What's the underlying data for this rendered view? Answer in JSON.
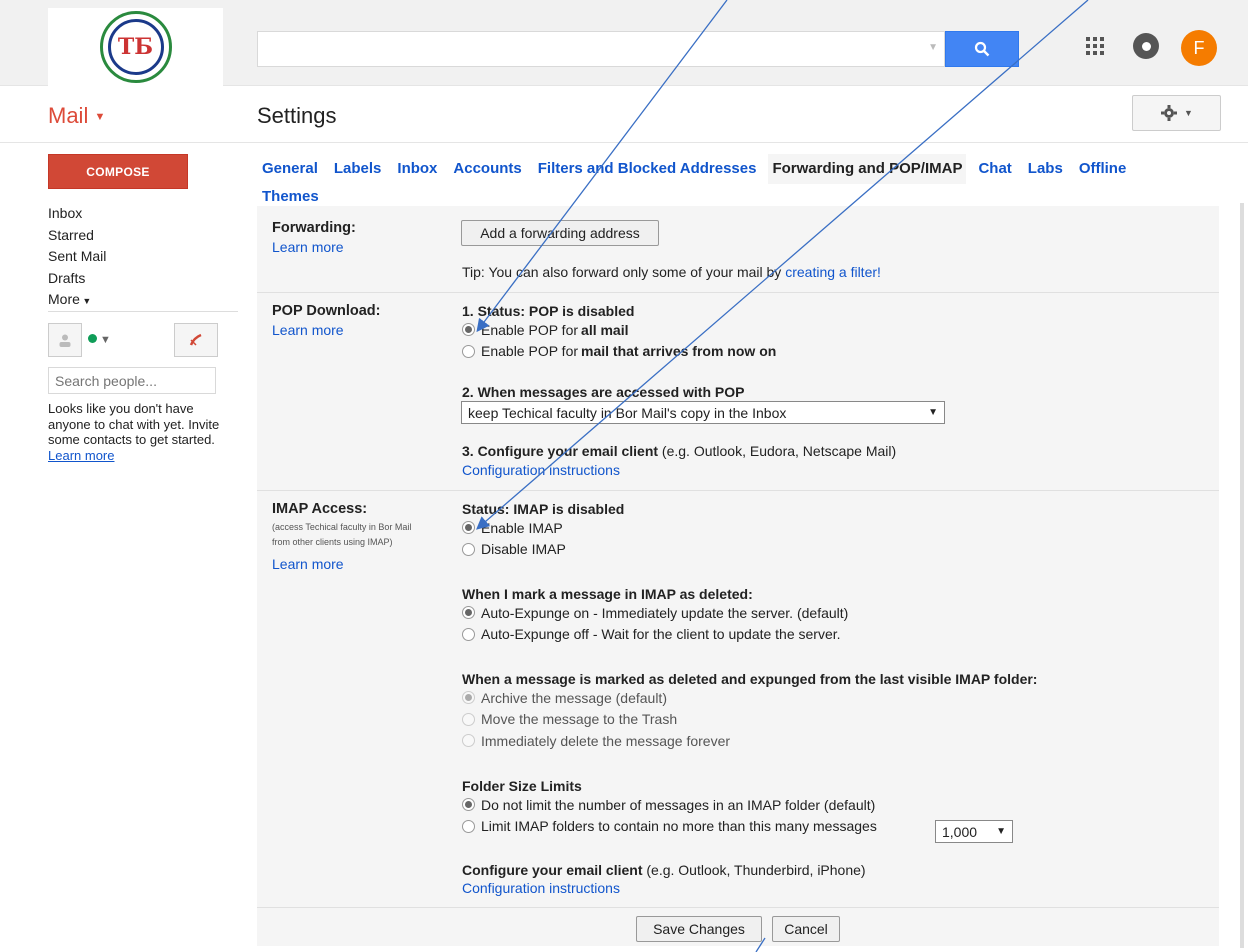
{
  "header": {
    "logo_text": "ТБ",
    "avatar_initial": "F",
    "app_label": "Mail",
    "page_title": "Settings"
  },
  "sidebar": {
    "compose_label": "COMPOSE",
    "items": [
      "Inbox",
      "Starred",
      "Sent Mail",
      "Drafts",
      "More"
    ],
    "people_search_placeholder": "Search people...",
    "chat_empty_text": "Looks like you don't have anyone to chat with yet. Invite some contacts to get started.",
    "chat_learn_more": "Learn more"
  },
  "tabs": [
    "General",
    "Labels",
    "Inbox",
    "Accounts",
    "Filters and Blocked Addresses",
    "Forwarding and POP/IMAP",
    "Chat",
    "Labs",
    "Offline",
    "Themes"
  ],
  "active_tab": "Forwarding and POP/IMAP",
  "forwarding": {
    "label": "Forwarding:",
    "learn_more": "Learn more",
    "add_button": "Add a forwarding address",
    "tip_prefix": "Tip: You can also forward only some of your mail by ",
    "tip_link": "creating a filter!"
  },
  "pop": {
    "label": "POP Download:",
    "learn_more": "Learn more",
    "status_heading": "1. Status: POP is disabled",
    "opt1_prefix": "Enable POP for ",
    "opt1_bold": "all mail",
    "opt2_prefix": "Enable POP for ",
    "opt2_bold": "mail that arrives from now on",
    "step2_heading": "2. When messages are accessed with POP",
    "step2_select": "keep Techical faculty in Bor Mail's copy in the Inbox",
    "step3_bold": "3. Configure your email client",
    "step3_rest": " (e.g. Outlook, Eudora, Netscape Mail)",
    "step3_link": "Configuration instructions"
  },
  "imap": {
    "label": "IMAP Access:",
    "sub": "(access Techical faculty in Bor Mail from other clients using IMAP)",
    "learn_more": "Learn more",
    "status_heading": "Status: IMAP is disabled",
    "enable": "Enable IMAP",
    "disable": "Disable IMAP",
    "deleted_heading": "When I mark a message in IMAP as deleted:",
    "expunge_on": "Auto-Expunge on - Immediately update the server. (default)",
    "expunge_off": "Auto-Expunge off - Wait for the client to update the server.",
    "expunged_heading": "When a message is marked as deleted and expunged from the last visible IMAP folder:",
    "archive": "Archive the message (default)",
    "trash": "Move the message to the Trash",
    "delete_forever": "Immediately delete the message forever",
    "folder_heading": "Folder Size Limits",
    "no_limit": "Do not limit the number of messages in an IMAP folder (default)",
    "limit": "Limit IMAP folders to contain no more than this many messages",
    "limit_value": "1,000",
    "config_bold": "Configure your email client",
    "config_rest": " (e.g. Outlook, Thunderbird, iPhone)",
    "config_link": "Configuration instructions"
  },
  "footer": {
    "save": "Save Changes",
    "cancel": "Cancel"
  },
  "colors": {
    "accent_red": "#dd4b39",
    "compose_red": "#d14836",
    "search_blue": "#4285f4",
    "link_blue": "#1155cc",
    "avatar_orange": "#f57c00",
    "annotation_arrow": "#3a6fc4"
  }
}
